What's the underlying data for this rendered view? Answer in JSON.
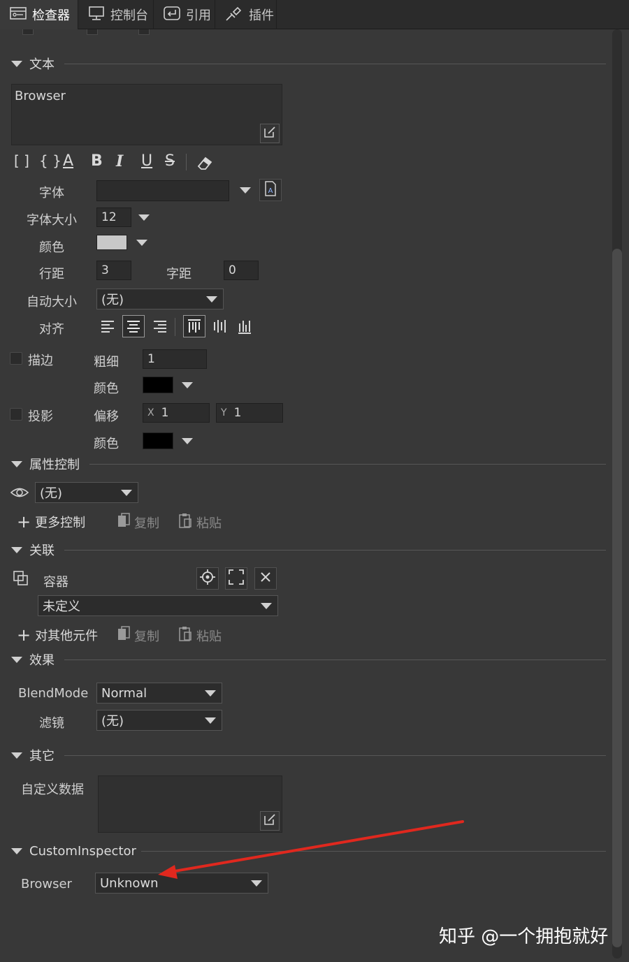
{
  "tabs": [
    {
      "label": "检查器",
      "icon": "inspector-icon"
    },
    {
      "label": "控制台",
      "icon": "monitor-icon"
    },
    {
      "label": "引用",
      "icon": "return-icon"
    },
    {
      "label": "插件",
      "icon": "plugin-icon"
    }
  ],
  "text_section": {
    "title": "文本",
    "text_value": "Browser",
    "font_label": "字体",
    "font_value": "",
    "font_size_label": "字体大小",
    "font_size_value": "12",
    "color_label": "颜色",
    "line_spacing_label": "行距",
    "line_spacing_value": "3",
    "letter_spacing_label": "字距",
    "letter_spacing_value": "0",
    "auto_size_label": "自动大小",
    "auto_size_value": "(无)",
    "align_label": "对齐",
    "stroke_label": "描边",
    "stroke_width_label": "粗细",
    "stroke_width_value": "1",
    "stroke_color_label": "颜色",
    "shadow_label": "投影",
    "shadow_offset_label": "偏移",
    "shadow_x_label": "X",
    "shadow_x_value": "1",
    "shadow_y_label": "Y",
    "shadow_y_value": "1",
    "shadow_color_label": "颜色",
    "format_buttons": [
      "[ ]",
      "{ }",
      "A",
      "B",
      "I",
      "U",
      "S"
    ],
    "text_color": "#c8c8c8",
    "stroke_color": "#000000",
    "shadow_color": "#000000"
  },
  "property_section": {
    "title": "属性控制",
    "visibility_value": "(无)",
    "more_control_label": "更多控制",
    "copy_label": "复制",
    "paste_label": "粘贴"
  },
  "relation_section": {
    "title": "关联",
    "container_label": "容器",
    "container_value": "未定义",
    "other_elements_label": "对其他元件",
    "copy_label": "复制",
    "paste_label": "粘贴"
  },
  "effect_section": {
    "title": "效果",
    "blend_mode_label": "BlendMode",
    "blend_mode_value": "Normal",
    "filter_label": "滤镜",
    "filter_value": "(无)"
  },
  "other_section": {
    "title": "其它",
    "custom_data_label": "自定义数据",
    "custom_data_value": ""
  },
  "custom_inspector_section": {
    "title": "CustomInspector",
    "browser_label": "Browser",
    "browser_value": "Unknown"
  },
  "watermark": "知乎 @一个拥抱就好",
  "colors": {
    "background": "#383838",
    "annotation_arrow": "#e0281e"
  }
}
